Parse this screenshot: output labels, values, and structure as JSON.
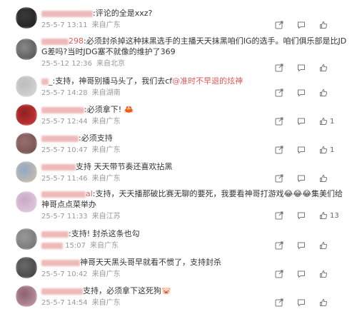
{
  "comments": [
    {
      "user_tail": "",
      "pre": "",
      "text": ":评论的全是xxz?",
      "mention": "",
      "post": "",
      "meta_date": "25-5-7 13:11",
      "meta_loc": "来自广东",
      "like_count": "",
      "avatar_colors": [
        "#1d1d1d",
        "#3a3a3a"
      ]
    },
    {
      "user_tail": "298",
      "pre": "",
      "text": ":必须封杀掉这种抹黑选手的主播天天抹黑咱们IG的选手。咱们俱乐部是比JDG差吗?当时JDG塞不就像的维护了369",
      "mention": "",
      "post": "",
      "meta_date": "25-5-12 12:36",
      "meta_loc": "来自北京",
      "like_count": "",
      "avatar_colors": [
        "#4a4a4a",
        "#8a8a8a"
      ]
    },
    {
      "user_tail": "",
      "pre": "",
      "text": "_:支持，神哥别播马头了，我们去cf",
      "mention": "@准时不早退的炫神",
      "post": "",
      "meta_date": "25-5-7 14:28",
      "meta_loc": "来自湖南",
      "like_count": "",
      "avatar_colors": [
        "#d9d9d9",
        "#bcbcbc"
      ]
    },
    {
      "user_tail": "",
      "pre": "",
      "text": ":必须拿下! 🦀",
      "mention": "",
      "post": "",
      "meta_date": "25-5-7 12:44",
      "meta_loc": "来自广东",
      "like_count": "1",
      "avatar_colors": [
        "#d23a3a",
        "#8f2020"
      ]
    },
    {
      "user_tail": "",
      "pre": "",
      "text": ":必须支持",
      "mention": "",
      "post": "",
      "meta_date": "25-5-7 10:47",
      "meta_loc": "来自广东",
      "like_count": "1",
      "avatar_colors": [
        "#6a4a4a",
        "#9a7070"
      ]
    },
    {
      "user_tail": "",
      "pre": "",
      "text": "支持 天天带节奏还喜欢拈黑",
      "mention": "",
      "post": "",
      "meta_date": "25-5-7 11:46",
      "meta_loc": "来自广东",
      "like_count": "",
      "avatar_colors": [
        "#d8c0a0",
        "#8fa8c8"
      ]
    },
    {
      "user_tail": "al",
      "pre": "",
      "text": ":支持，天天播那破比赛无聊的要死，我要看神哥打游戏😂😂😂集美们给神哥点点菜举办",
      "mention": "",
      "post": "",
      "meta_date": "25-5-7 11:33",
      "meta_loc": "来自江苏",
      "like_count": "13",
      "avatar_colors": [
        "#e8d0e0",
        "#c8a8c8"
      ]
    },
    {
      "user_tail": "",
      "pre": "",
      "text": ":支持! 封杀这条也勾",
      "mention": "",
      "post": "",
      "meta_date": "15:07",
      "meta_loc": "来自广东",
      "like_count": "",
      "avatar_colors": [
        "#6a6a6a",
        "#9a9a9a"
      ]
    },
    {
      "user_tail": "",
      "pre": "",
      "text": "神哥天天黑头哥早就看不惯了，支持封杀",
      "mention": "",
      "post": "",
      "meta_date": "25-5-7 10:42",
      "meta_loc": "来自广东",
      "like_count": "",
      "avatar_colors": [
        "#3a3a3a",
        "#6a6a6a"
      ]
    },
    {
      "user_tail": "",
      "pre": "",
      "text": "支持，必须拿下这死狗🐷",
      "mention": "",
      "post": "",
      "meta_date": "25-5-7 14:54",
      "meta_loc": "来自广东",
      "like_count": "",
      "avatar_colors": [
        "#c8a0a8",
        "#8a6070"
      ]
    }
  ],
  "colors": {
    "mention": "#e05a5a",
    "meta": "#999999",
    "text": "#333333"
  },
  "icons": [
    "share-icon",
    "comment-icon",
    "like-icon"
  ]
}
